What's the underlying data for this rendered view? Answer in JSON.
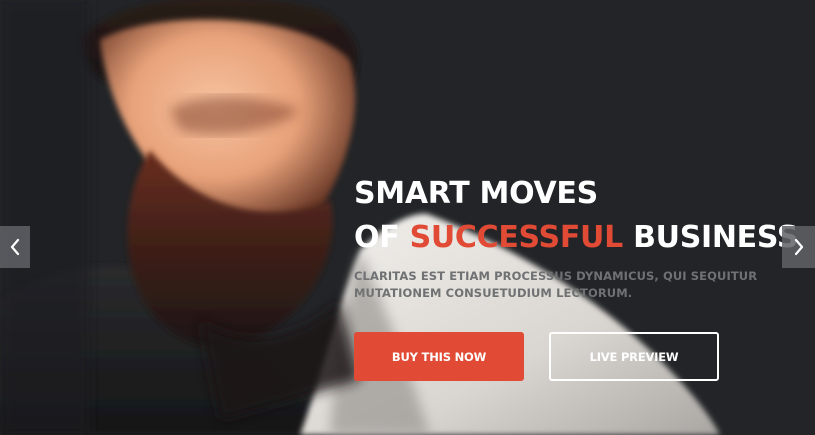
{
  "hero": {
    "headline_line1": "SMART MOVES",
    "headline_line2_prefix": "OF",
    "headline_line2_accent": "SUCCESSFUL",
    "headline_line2_suffix": "BUSINESS",
    "subtext": "CLARITAS EST ETIAM PROCESSUS DYNAMICUS, QUI SEQUITUR MUTATIONEM CONSUETUDIUM LECTORUM."
  },
  "buttons": {
    "primary_label": "BUY THIS NOW",
    "secondary_label": "LIVE PREVIEW"
  },
  "navigation": {
    "prev_icon": "chevron-left-icon",
    "next_icon": "chevron-right-icon"
  },
  "colors": {
    "accent": "#e14a35",
    "background": "#222427",
    "text": "#ffffff",
    "subtext": "#6f7173"
  }
}
